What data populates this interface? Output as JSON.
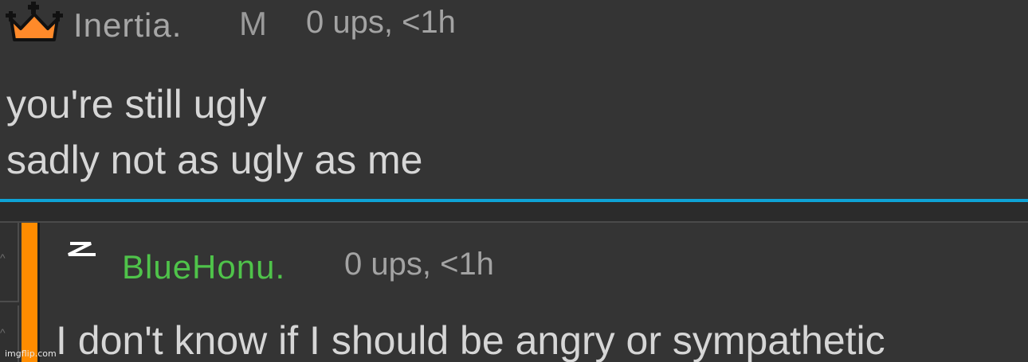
{
  "comment": {
    "username": "Inertia.",
    "badge": "M",
    "meta": "0 ups, <1h",
    "lines": [
      "you're still ugly",
      "sadly not as ugly as me"
    ],
    "icon": "crown-icon",
    "crown_color": "#ff8a2a"
  },
  "reply": {
    "username": "BlueHonu.",
    "meta": "0 ups, <1h",
    "text": "I don't know if I should be angry or sympathetic",
    "icon": "mod-lightning-icon",
    "username_color": "#4fc34a",
    "thread_color": "#ff8c00"
  },
  "divider_color": "#0ea3d6",
  "watermark": "imgflip.com"
}
